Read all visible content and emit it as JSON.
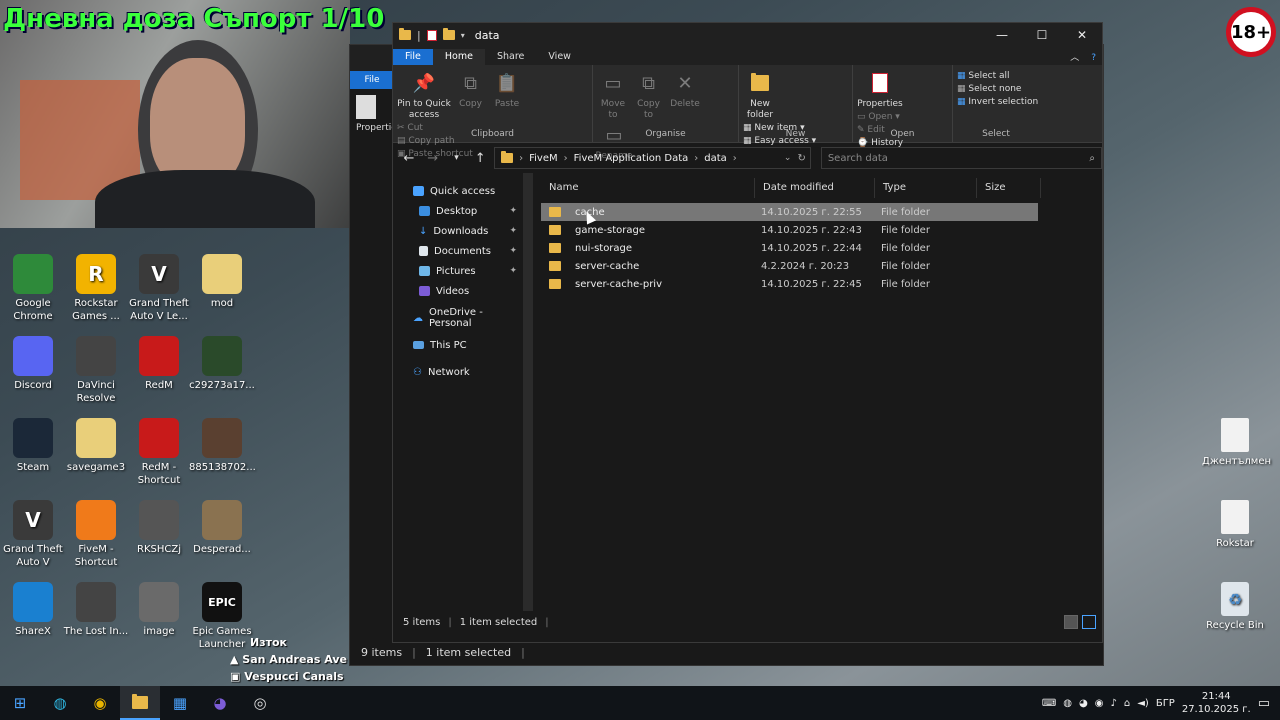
{
  "overlay": {
    "stream_title": "Дневна доза Съпорт 1/10",
    "age_badge": "18+"
  },
  "desktop_icons": [
    {
      "label": "Google\nChrome",
      "icon": "chrome-icon",
      "color": "#2e8a3a"
    },
    {
      "label": "Rockstar\nGames ...",
      "icon": "rockstar-icon",
      "color": "#f2b300",
      "glyph": "R"
    },
    {
      "label": "Grand Theft\nAuto V Le...",
      "icon": "gta-v-icon",
      "color": "#3a3a3a",
      "glyph": "V"
    },
    {
      "label": "mod",
      "icon": "folder-icon",
      "color": "#e9cf7a"
    },
    {
      "label": "Discord",
      "icon": "discord-icon",
      "color": "#5865f2"
    },
    {
      "label": "DaVinci\nResolve",
      "icon": "davinci-icon",
      "color": "#444"
    },
    {
      "label": "RedM",
      "icon": "redm-icon",
      "color": "#c81a1a"
    },
    {
      "label": "c29273a17...",
      "icon": "image-file-icon",
      "color": "#2a4a2a"
    },
    {
      "label": "Steam",
      "icon": "steam-icon",
      "color": "#1b2838"
    },
    {
      "label": "savegame3",
      "icon": "folder-icon",
      "color": "#e9cf7a"
    },
    {
      "label": "RedM -\nShortcut",
      "icon": "redm-icon",
      "color": "#c81a1a"
    },
    {
      "label": "885138702...",
      "icon": "image-file-icon",
      "color": "#5a4030"
    },
    {
      "label": "Grand Theft\nAuto V",
      "icon": "gta-v-icon",
      "color": "#3a3a3a",
      "glyph": "V"
    },
    {
      "label": "FiveM -\nShortcut",
      "icon": "fivem-icon",
      "color": "#f07a1a"
    },
    {
      "label": "RKSHCZj",
      "icon": "image-file-icon",
      "color": "#555"
    },
    {
      "label": "Desperad...",
      "icon": "image-file-icon",
      "color": "#8a7250"
    },
    {
      "label": "ShareX",
      "icon": "sharex-icon",
      "color": "#1a80d0"
    },
    {
      "label": "The Lost In...",
      "icon": "image-file-icon",
      "color": "#444"
    },
    {
      "label": "image",
      "icon": "image-file-icon",
      "color": "#6a6a6a"
    },
    {
      "label": "Epic Games\nLauncher",
      "icon": "epic-games-icon",
      "color": "#111",
      "glyph": "EPIC"
    }
  ],
  "right_icons": [
    {
      "label": "Джентълмен",
      "icon": "document-icon"
    },
    {
      "label": "Rokstar",
      "icon": "document-icon"
    },
    {
      "label": "Recycle Bin",
      "icon": "recycle-bin-icon"
    }
  ],
  "map_locations": {
    "line1": "Изток",
    "line2": "San Andreas Ave",
    "line3": "Vespucci Canals"
  },
  "back_window": {
    "status_items": "9 items",
    "status_selected": "1 item selected"
  },
  "explorer": {
    "title": "data",
    "tabs": [
      "File",
      "Home",
      "Share",
      "View"
    ],
    "ribbon": {
      "pin": "Pin to Quick access",
      "copy": "Copy",
      "paste": "Paste",
      "cut": "Cut",
      "copy_path": "Copy path",
      "paste_shortcut": "Paste shortcut",
      "clipboard": "Clipboard",
      "move_to": "Move to",
      "copy_to": "Copy to",
      "delete": "Delete",
      "rename": "Rename",
      "organise": "Organise",
      "new_folder": "New folder",
      "new_item": "New item",
      "easy_access": "Easy access",
      "new": "New",
      "properties": "Properties",
      "open_btn": "Open",
      "edit": "Edit",
      "history": "History",
      "open_grp": "Open",
      "select_all": "Select all",
      "select_none": "Select none",
      "invert_selection": "Invert selection",
      "select": "Select"
    },
    "breadcrumb": [
      "FiveM",
      "FiveM Application Data",
      "data"
    ],
    "search_placeholder": "Search data",
    "nav": {
      "quick_access": "Quick access",
      "desktop": "Desktop",
      "downloads": "Downloads",
      "documents": "Documents",
      "pictures": "Pictures",
      "videos": "Videos",
      "onedrive": "OneDrive - Personal",
      "this_pc": "This PC",
      "network": "Network"
    },
    "columns": {
      "name": "Name",
      "date": "Date modified",
      "type": "Type",
      "size": "Size"
    },
    "files": [
      {
        "name": "cache",
        "date": "14.10.2025 г. 22:55",
        "type": "File folder"
      },
      {
        "name": "game-storage",
        "date": "14.10.2025 г. 22:43",
        "type": "File folder"
      },
      {
        "name": "nui-storage",
        "date": "14.10.2025 г. 22:44",
        "type": "File folder"
      },
      {
        "name": "server-cache",
        "date": "4.2.2024 г. 20:23",
        "type": "File folder"
      },
      {
        "name": "server-cache-priv",
        "date": "14.10.2025 г. 22:45",
        "type": "File folder"
      }
    ],
    "status_items": "5 items",
    "status_selected": "1 item selected"
  },
  "taskbar": {
    "lang": "БГР",
    "time": "21:44",
    "date": "27.10.2025 г."
  }
}
